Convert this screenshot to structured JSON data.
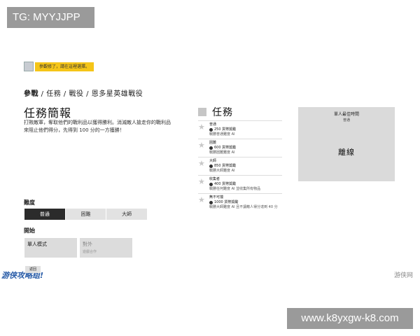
{
  "watermark": {
    "tg_label": "TG: MYYJJPP",
    "url_label": "www.k8yxgw-k8.com"
  },
  "notice": {
    "text": "參觀修了，請在這裡選擇。"
  },
  "breadcrumb": {
    "items": [
      "參戰",
      "任務",
      "戰役",
      "恩多星英雄戰役"
    ],
    "separator": " / "
  },
  "brief": {
    "title": "任務簡報",
    "description": "打敗敵軍，奪取他們的戰利品以獲得勝利。消滅敵人搶走你的戰利品來阻止他們得分，先得到 100 分的一方獲勝！"
  },
  "difficulty": {
    "label": "難度",
    "options": [
      "普通",
      "困難",
      "大師"
    ],
    "selected": "普通"
  },
  "start": {
    "label": "開始",
    "modes": [
      {
        "label": "單人模式",
        "sub": ""
      },
      {
        "label": "對外",
        "sub": "遊戲合作"
      }
    ]
  },
  "missions": {
    "title": "任務",
    "items": [
      {
        "name": "普通",
        "reward": "250 貨幣獎勵",
        "desc": "戰勝普通難度 AI"
      },
      {
        "name": "困難",
        "reward": "600 貨幣獎勵",
        "desc": "戰勝困難難度 AI"
      },
      {
        "name": "大師",
        "reward": "850 貨幣獎勵",
        "desc": "戰勝大師難度 AI"
      },
      {
        "name": "收集者",
        "reward": "400 貨幣獎勵",
        "desc": "戰勝任何難度 AI 並收集所有物品"
      },
      {
        "name": "無不可擋",
        "reward": "1000 貨幣獎勵",
        "desc": "戰勝大師難度 AI 且不讓敵人得分達到 40 分"
      }
    ]
  },
  "record": {
    "title": "單人最佳時間",
    "subtitle": "普通",
    "status": "離線"
  },
  "footer": {
    "back_label": "返回",
    "logo_left": "游侠攻略组!",
    "logo_right": "游侠网"
  },
  "colors": {
    "notice_bg": "#f5c518",
    "selected_difficulty_bg": "#2b2b2b",
    "card_bg": "#dadada"
  },
  "icons": {
    "mission_star": "star-icon",
    "reward_coin": "coin-icon"
  }
}
